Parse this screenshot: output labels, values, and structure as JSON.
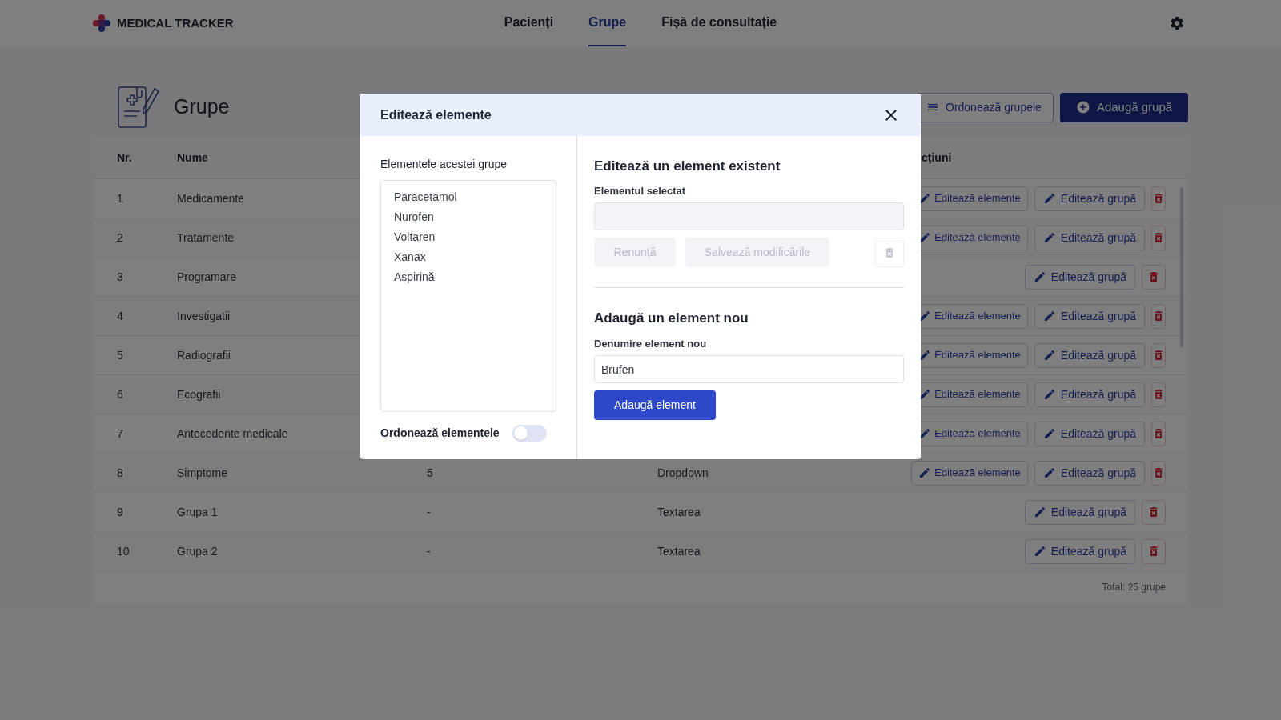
{
  "app": {
    "logo": "MEDICAL TRACKER"
  },
  "nav": [
    {
      "label": "Pacienți",
      "selected": false
    },
    {
      "label": "Grupe",
      "selected": true
    },
    {
      "label": "Fișă de consultație",
      "selected": false
    }
  ],
  "page": {
    "title": "Grupe",
    "buttons": [
      {
        "kind": "order",
        "label": "Ordonează grupele"
      },
      {
        "kind": "add",
        "label": "Adaugă grupă"
      }
    ]
  },
  "table": {
    "columns": [
      "Nr.",
      "Nume"
    ],
    "actions_header": "cțiuni",
    "rows": [
      {
        "nr": "1",
        "name": "Medicamente",
        "actions": [
          {
            "kind": "elements",
            "label": "Editează elemente"
          },
          {
            "kind": "edit",
            "label": "Editează grupă"
          },
          {
            "kind": "delete"
          }
        ]
      },
      {
        "nr": "2",
        "name": "Tratamente",
        "actions": [
          {
            "kind": "elements",
            "label": "Editează elemente"
          },
          {
            "kind": "edit",
            "label": "Editează grupă"
          },
          {
            "kind": "delete"
          }
        ]
      },
      {
        "nr": "3",
        "name": "Programare",
        "actions": [
          {
            "kind": "edit",
            "label": "Editează grupă"
          },
          {
            "kind": "delete"
          }
        ]
      },
      {
        "nr": "4",
        "name": "Investigatii",
        "actions": [
          {
            "kind": "elements",
            "label": "Editează elemente"
          },
          {
            "kind": "edit",
            "label": "Editează grupă"
          },
          {
            "kind": "delete"
          }
        ]
      },
      {
        "nr": "5",
        "name": "Radiografii",
        "actions": [
          {
            "kind": "elements",
            "label": "Editează elemente"
          },
          {
            "kind": "edit",
            "label": "Editează grupă"
          },
          {
            "kind": "delete"
          }
        ]
      },
      {
        "nr": "6",
        "name": "Ecografii",
        "actions": [
          {
            "kind": "elements",
            "label": "Editează elemente"
          },
          {
            "kind": "edit",
            "label": "Editează grupă"
          },
          {
            "kind": "delete"
          }
        ]
      },
      {
        "nr": "7",
        "name": "Antecedente medicale",
        "actions": [
          {
            "kind": "elements",
            "label": "Editează elemente"
          },
          {
            "kind": "edit",
            "label": "Editează grupă"
          },
          {
            "kind": "delete"
          }
        ]
      },
      {
        "nr": "8",
        "name": "Simptome",
        "column_3": "5",
        "column_4": "Dropdown",
        "actions": [
          {
            "kind": "elements",
            "label": "Editează elemente"
          },
          {
            "kind": "edit",
            "label": "Editează grupă"
          },
          {
            "kind": "delete"
          }
        ]
      },
      {
        "nr": "9",
        "name": "Grupa 1",
        "column_3": "-",
        "column_4": "Textarea",
        "actions": [
          {
            "kind": "edit",
            "label": "Editează grupă"
          },
          {
            "kind": "delete"
          }
        ]
      },
      {
        "nr": "10",
        "name": "Grupa 2",
        "column_3": "-",
        "column_4": "Textarea",
        "actions": [
          {
            "kind": "edit",
            "label": "Editează grupă"
          },
          {
            "kind": "delete"
          }
        ]
      }
    ],
    "footer": "Total: 25 grupe"
  },
  "modal": {
    "title": "Editează elemente",
    "list_label": "Elementele acestei grupe",
    "items": [
      "Paracetamol",
      "Nurofen",
      "Voltaren",
      "Xanax",
      "Aspirină"
    ],
    "order_toggle": {
      "label": "Ordonează elementele",
      "on": false
    },
    "edit": {
      "heading": "Editează un element existent",
      "field_label": "Elementul selectat",
      "cancel": "Renunță",
      "save": "Salvează modificările",
      "disabled": true
    },
    "add": {
      "heading": "Adaugă un element nou",
      "field_label": "Denumire element nou",
      "value": "Brufen",
      "button": "Adaugă element"
    }
  }
}
